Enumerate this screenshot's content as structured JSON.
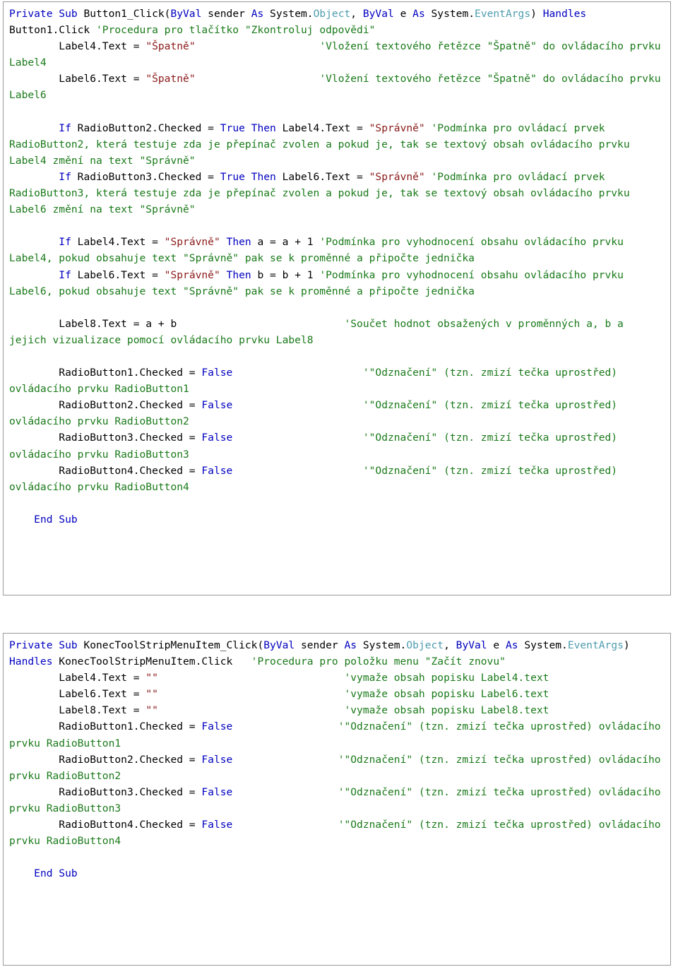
{
  "document": {
    "language": "VB.NET",
    "title": "VB.NET event handler code listing (Czech comments)",
    "colors": {
      "keyword": "#0000C0",
      "type": "#4E9CAF",
      "string": "#8B1A1A",
      "comment": "#1A7A1A",
      "plain": "#000000",
      "border": "#999999",
      "background": "#ffffff"
    }
  },
  "blocks": [
    {
      "name": "button1-click-procedure",
      "lines": [
        [
          {
            "t": "kw",
            "v": "Private Sub "
          },
          {
            "t": "pln",
            "v": "Button1_Click("
          },
          {
            "t": "kw",
            "v": "ByVal "
          },
          {
            "t": "pln",
            "v": "sender "
          },
          {
            "t": "kw",
            "v": "As "
          },
          {
            "t": "pln",
            "v": "System."
          },
          {
            "t": "type",
            "v": "Object"
          },
          {
            "t": "pln",
            "v": ", "
          },
          {
            "t": "kw",
            "v": "ByVal "
          },
          {
            "t": "pln",
            "v": "e "
          },
          {
            "t": "kw",
            "v": "As "
          },
          {
            "t": "pln",
            "v": "System."
          },
          {
            "t": "type",
            "v": "EventArgs"
          },
          {
            "t": "pln",
            "v": ") "
          },
          {
            "t": "kw",
            "v": "Handles "
          },
          {
            "t": "pln",
            "v": "Button1.Click "
          },
          {
            "t": "com",
            "v": "'Procedura pro tlačítko \"Zkontroluj odpovědi\""
          }
        ],
        [
          {
            "t": "pln",
            "v": "        Label4.Text = "
          },
          {
            "t": "str",
            "v": "\"Špatně\""
          },
          {
            "t": "pln",
            "v": "                    "
          },
          {
            "t": "com",
            "v": "'Vložení textového řetězce \"Špatně\" do ovládacího prvku Label4"
          }
        ],
        [
          {
            "t": "pln",
            "v": "        Label6.Text = "
          },
          {
            "t": "str",
            "v": "\"Špatně\""
          },
          {
            "t": "pln",
            "v": "                    "
          },
          {
            "t": "com",
            "v": "'Vložení textového řetězce \"Špatně\" do ovládacího prvku Label6"
          }
        ],
        [],
        [
          {
            "t": "pln",
            "v": "        "
          },
          {
            "t": "kw",
            "v": "If "
          },
          {
            "t": "pln",
            "v": "RadioButton2.Checked = "
          },
          {
            "t": "kw",
            "v": "True Then "
          },
          {
            "t": "pln",
            "v": "Label4.Text = "
          },
          {
            "t": "str",
            "v": "\"Správně\""
          },
          {
            "t": "pln",
            "v": " "
          },
          {
            "t": "com",
            "v": "'Podmínka pro ovládací prvek RadioButton2, která testuje zda je přepínač zvolen a pokud je, tak se textový obsah ovládacího prvku Label4 změní na text \"Správně\""
          }
        ],
        [
          {
            "t": "pln",
            "v": "        "
          },
          {
            "t": "kw",
            "v": "If "
          },
          {
            "t": "pln",
            "v": "RadioButton3.Checked = "
          },
          {
            "t": "kw",
            "v": "True Then "
          },
          {
            "t": "pln",
            "v": "Label6.Text = "
          },
          {
            "t": "str",
            "v": "\"Správně\""
          },
          {
            "t": "pln",
            "v": " "
          },
          {
            "t": "com",
            "v": "'Podmínka pro ovládací prvek RadioButton3, která testuje zda je přepínač zvolen a pokud je, tak se textový obsah ovládacího prvku Label6 změní na text \"Správně\""
          }
        ],
        [],
        [
          {
            "t": "pln",
            "v": "        "
          },
          {
            "t": "kw",
            "v": "If "
          },
          {
            "t": "pln",
            "v": "Label4.Text = "
          },
          {
            "t": "str",
            "v": "\"Správně\""
          },
          {
            "t": "pln",
            "v": " "
          },
          {
            "t": "kw",
            "v": "Then "
          },
          {
            "t": "pln",
            "v": "a = a + 1 "
          },
          {
            "t": "com",
            "v": "'Podmínka pro vyhodnocení obsahu ovládacího prvku Label4, pokud obsahuje text \"Správně\" pak se k proměnné a připočte jednička"
          }
        ],
        [
          {
            "t": "pln",
            "v": "        "
          },
          {
            "t": "kw",
            "v": "If "
          },
          {
            "t": "pln",
            "v": "Label6.Text = "
          },
          {
            "t": "str",
            "v": "\"Správně\""
          },
          {
            "t": "pln",
            "v": " "
          },
          {
            "t": "kw",
            "v": "Then "
          },
          {
            "t": "pln",
            "v": "b = b + 1 "
          },
          {
            "t": "com",
            "v": "'Podmínka pro vyhodnocení obsahu ovládacího prvku Label6, pokud obsahuje text \"Správně\" pak se k proměnné a připočte jednička"
          }
        ],
        [],
        [
          {
            "t": "pln",
            "v": "        Label8.Text = a + b"
          },
          {
            "t": "pln",
            "v": "                           "
          },
          {
            "t": "com",
            "v": "'Součet hodnot obsažených v proměnných a, b a jejich vizualizace pomocí ovládacího prvku Label8"
          }
        ],
        [],
        [
          {
            "t": "pln",
            "v": "        RadioButton1.Checked = "
          },
          {
            "t": "kw",
            "v": "False"
          },
          {
            "t": "pln",
            "v": "                     "
          },
          {
            "t": "com",
            "v": "'\"Odznačení\" (tzn. zmizí tečka uprostřed) ovládacího prvku RadioButton1"
          }
        ],
        [
          {
            "t": "pln",
            "v": "        RadioButton2.Checked = "
          },
          {
            "t": "kw",
            "v": "False"
          },
          {
            "t": "pln",
            "v": "                     "
          },
          {
            "t": "com",
            "v": "'\"Odznačení\" (tzn. zmizí tečka uprostřed) ovládacího prvku RadioButton2"
          }
        ],
        [
          {
            "t": "pln",
            "v": "        RadioButton3.Checked = "
          },
          {
            "t": "kw",
            "v": "False"
          },
          {
            "t": "pln",
            "v": "                     "
          },
          {
            "t": "com",
            "v": "'\"Odznačení\" (tzn. zmizí tečka uprostřed) ovládacího prvku RadioButton3"
          }
        ],
        [
          {
            "t": "pln",
            "v": "        RadioButton4.Checked = "
          },
          {
            "t": "kw",
            "v": "False"
          },
          {
            "t": "pln",
            "v": "                     "
          },
          {
            "t": "com",
            "v": "'\"Odznačení\" (tzn. zmizí tečka uprostřed) ovládacího prvku RadioButton4"
          }
        ],
        [],
        [
          {
            "t": "pln",
            "v": "    "
          },
          {
            "t": "kw",
            "v": "End Sub"
          }
        ]
      ]
    },
    {
      "name": "konectoolstripmenuitem-click-procedure",
      "lines": [
        [
          {
            "t": "kw",
            "v": "Private Sub "
          },
          {
            "t": "pln",
            "v": "KonecToolStripMenuItem_Click("
          },
          {
            "t": "kw",
            "v": "ByVal "
          },
          {
            "t": "pln",
            "v": "sender "
          },
          {
            "t": "kw",
            "v": "As "
          },
          {
            "t": "pln",
            "v": "System."
          },
          {
            "t": "type",
            "v": "Object"
          },
          {
            "t": "pln",
            "v": ", "
          },
          {
            "t": "kw",
            "v": "ByVal "
          },
          {
            "t": "pln",
            "v": "e "
          },
          {
            "t": "kw",
            "v": "As "
          },
          {
            "t": "pln",
            "v": "System."
          },
          {
            "t": "type",
            "v": "EventArgs"
          },
          {
            "t": "pln",
            "v": ") "
          },
          {
            "t": "kw",
            "v": "Handles "
          },
          {
            "t": "pln",
            "v": "KonecToolStripMenuItem.Click   "
          },
          {
            "t": "com",
            "v": "'Procedura pro položku menu \"Začít znovu\""
          }
        ],
        [
          {
            "t": "pln",
            "v": "        Label4.Text = "
          },
          {
            "t": "str",
            "v": "\"\""
          },
          {
            "t": "pln",
            "v": "                              "
          },
          {
            "t": "com",
            "v": "'vymaže obsah popisku Label4.text"
          }
        ],
        [
          {
            "t": "pln",
            "v": "        Label6.Text = "
          },
          {
            "t": "str",
            "v": "\"\""
          },
          {
            "t": "pln",
            "v": "                              "
          },
          {
            "t": "com",
            "v": "'vymaže obsah popisku Label6.text"
          }
        ],
        [
          {
            "t": "pln",
            "v": "        Label8.Text = "
          },
          {
            "t": "str",
            "v": "\"\""
          },
          {
            "t": "pln",
            "v": "                              "
          },
          {
            "t": "com",
            "v": "'vymaže obsah popisku Label8.text"
          }
        ],
        [
          {
            "t": "pln",
            "v": "        RadioButton1.Checked = "
          },
          {
            "t": "kw",
            "v": "False"
          },
          {
            "t": "pln",
            "v": "                 "
          },
          {
            "t": "com",
            "v": "'\"Odznačení\" (tzn. zmizí tečka uprostřed) ovládacího prvku RadioButton1"
          }
        ],
        [
          {
            "t": "pln",
            "v": "        RadioButton2.Checked = "
          },
          {
            "t": "kw",
            "v": "False"
          },
          {
            "t": "pln",
            "v": "                 "
          },
          {
            "t": "com",
            "v": "'\"Odznačení\" (tzn. zmizí tečka uprostřed) ovládacího prvku RadioButton2"
          }
        ],
        [
          {
            "t": "pln",
            "v": "        RadioButton3.Checked = "
          },
          {
            "t": "kw",
            "v": "False"
          },
          {
            "t": "pln",
            "v": "                 "
          },
          {
            "t": "com",
            "v": "'\"Odznačení\" (tzn. zmizí tečka uprostřed) ovládacího prvku RadioButton3"
          }
        ],
        [
          {
            "t": "pln",
            "v": "        RadioButton4.Checked = "
          },
          {
            "t": "kw",
            "v": "False"
          },
          {
            "t": "pln",
            "v": "                 "
          },
          {
            "t": "com",
            "v": "'\"Odznačení\" (tzn. zmizí tečka uprostřed) ovládacího prvku RadioButton4"
          }
        ],
        [],
        [
          {
            "t": "pln",
            "v": "    "
          },
          {
            "t": "kw",
            "v": "End Sub"
          }
        ]
      ]
    }
  ]
}
